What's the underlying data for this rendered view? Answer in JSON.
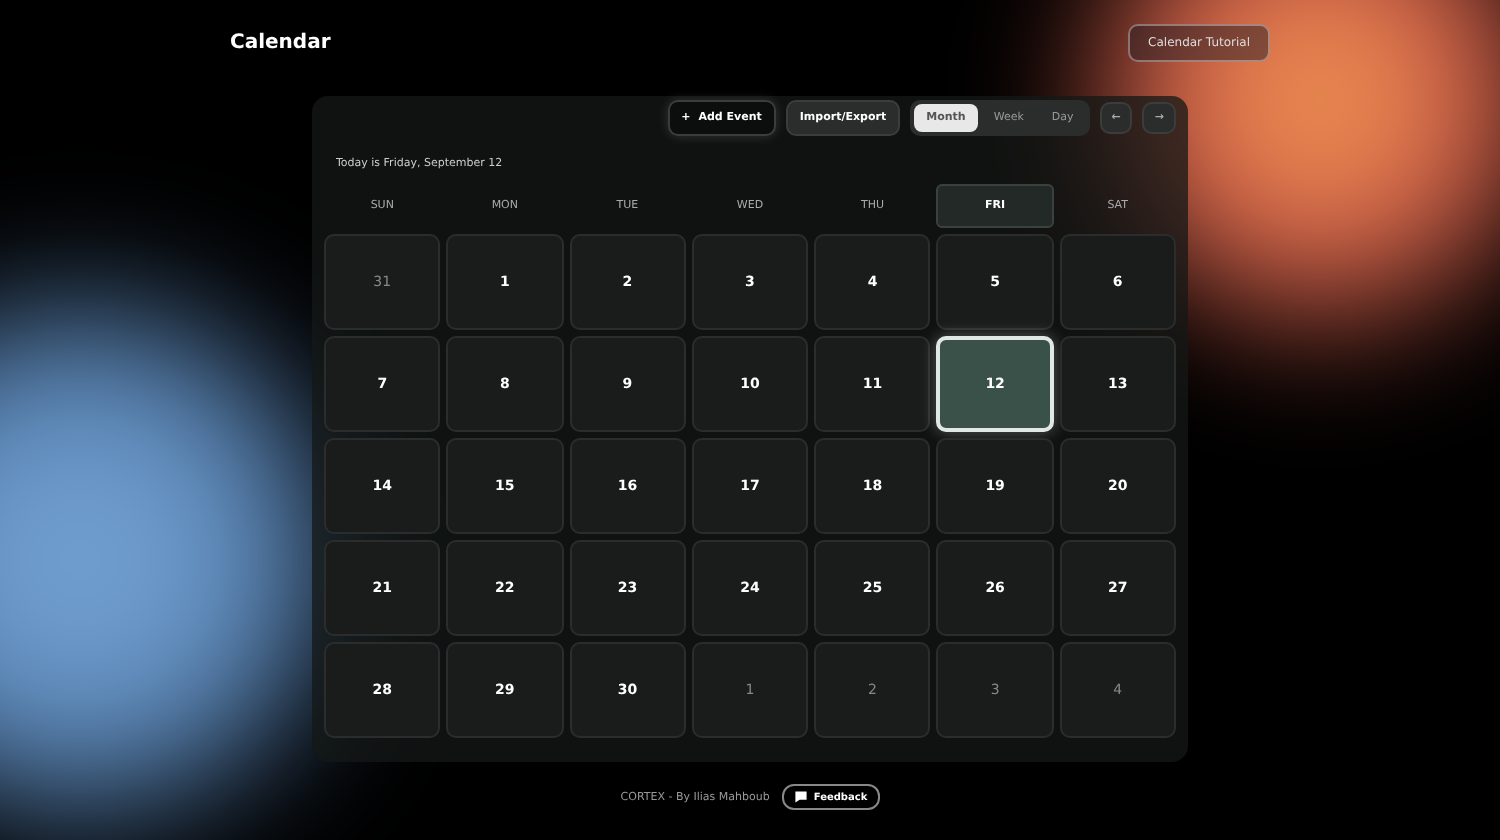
{
  "header": {
    "title": "Calendar",
    "tutorial_button": "Calendar Tutorial"
  },
  "toolbar": {
    "add_event": {
      "icon": "+",
      "label": "Add Event"
    },
    "import_export": "Import/Export",
    "views": [
      {
        "label": "Month",
        "selected": true
      },
      {
        "label": "Week",
        "selected": false
      },
      {
        "label": "Day",
        "selected": false
      }
    ],
    "prev": "←",
    "next": "→"
  },
  "today_text": "Today is Friday, September 12",
  "weekdays": [
    {
      "label": "SUN",
      "selected": false
    },
    {
      "label": "MON",
      "selected": false
    },
    {
      "label": "TUE",
      "selected": false
    },
    {
      "label": "WED",
      "selected": false
    },
    {
      "label": "THU",
      "selected": false
    },
    {
      "label": "FRI",
      "selected": true
    },
    {
      "label": "SAT",
      "selected": false
    }
  ],
  "days": [
    {
      "label": "31",
      "in_month": false,
      "selected": false
    },
    {
      "label": "1",
      "in_month": true,
      "selected": false
    },
    {
      "label": "2",
      "in_month": true,
      "selected": false
    },
    {
      "label": "3",
      "in_month": true,
      "selected": false
    },
    {
      "label": "4",
      "in_month": true,
      "selected": false
    },
    {
      "label": "5",
      "in_month": true,
      "selected": false
    },
    {
      "label": "6",
      "in_month": true,
      "selected": false
    },
    {
      "label": "7",
      "in_month": true,
      "selected": false
    },
    {
      "label": "8",
      "in_month": true,
      "selected": false
    },
    {
      "label": "9",
      "in_month": true,
      "selected": false
    },
    {
      "label": "10",
      "in_month": true,
      "selected": false
    },
    {
      "label": "11",
      "in_month": true,
      "selected": false
    },
    {
      "label": "12",
      "in_month": true,
      "selected": true
    },
    {
      "label": "13",
      "in_month": true,
      "selected": false
    },
    {
      "label": "14",
      "in_month": true,
      "selected": false
    },
    {
      "label": "15",
      "in_month": true,
      "selected": false
    },
    {
      "label": "16",
      "in_month": true,
      "selected": false
    },
    {
      "label": "17",
      "in_month": true,
      "selected": false
    },
    {
      "label": "18",
      "in_month": true,
      "selected": false
    },
    {
      "label": "19",
      "in_month": true,
      "selected": false
    },
    {
      "label": "20",
      "in_month": true,
      "selected": false
    },
    {
      "label": "21",
      "in_month": true,
      "selected": false
    },
    {
      "label": "22",
      "in_month": true,
      "selected": false
    },
    {
      "label": "23",
      "in_month": true,
      "selected": false
    },
    {
      "label": "24",
      "in_month": true,
      "selected": false
    },
    {
      "label": "25",
      "in_month": true,
      "selected": false
    },
    {
      "label": "26",
      "in_month": true,
      "selected": false
    },
    {
      "label": "27",
      "in_month": true,
      "selected": false
    },
    {
      "label": "28",
      "in_month": true,
      "selected": false
    },
    {
      "label": "29",
      "in_month": true,
      "selected": false
    },
    {
      "label": "30",
      "in_month": true,
      "selected": false
    },
    {
      "label": "1",
      "in_month": false,
      "selected": false
    },
    {
      "label": "2",
      "in_month": false,
      "selected": false
    },
    {
      "label": "3",
      "in_month": false,
      "selected": false
    },
    {
      "label": "4",
      "in_month": false,
      "selected": false
    }
  ],
  "footer": {
    "credit": "CORTEX - By Ilias Mahboub",
    "feedback": "Feedback"
  }
}
